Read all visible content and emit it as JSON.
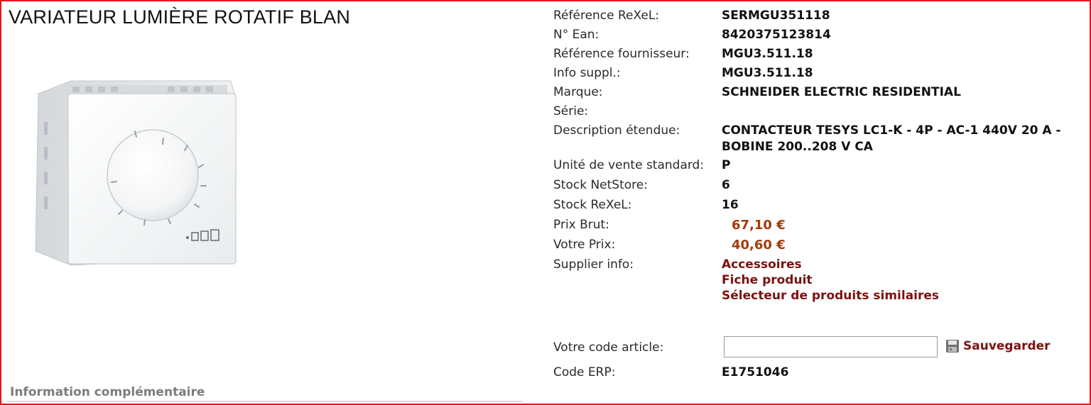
{
  "product": {
    "title": "VARIATEUR LUMIÈRE ROTATIF BLAN",
    "image_icon": "dimmer-switch-product-photo",
    "info_heading": "Information complémentaire"
  },
  "details": {
    "ref_rexel_label": "Référence ReXeL:",
    "ref_rexel_value": "SERMGU351118",
    "ean_label": "N° Ean:",
    "ean_value": "8420375123814",
    "ref_supplier_label": "Référence fournisseur:",
    "ref_supplier_value": "MGU3.511.18",
    "info_suppl_label": "Info suppl.:",
    "info_suppl_value": "MGU3.511.18",
    "brand_label": "Marque:",
    "brand_value": "SCHNEIDER ELECTRIC RESIDENTIAL",
    "series_label": "Série:",
    "series_value": "",
    "description_label": "Description étendue:",
    "description_line1": "CONTACTEUR TESYS LC1-K - 4P - AC-1 440V 20 A -",
    "description_line2": "BOBINE 200..208 V CA",
    "unit_label": "Unité de vente standard:",
    "unit_value": "P",
    "stock_netstore_label": "Stock NetStore:",
    "stock_netstore_value": "6",
    "stock_rexel_label": "Stock ReXeL:",
    "stock_rexel_value": "16",
    "price_gross_label": "Prix Brut:",
    "price_gross_value": "67,10 €",
    "price_yours_label": "Votre Prix:",
    "price_yours_value": "40,60 €",
    "supplier_info_label": "Supplier info:",
    "links": [
      "Accessoires",
      "Fiche produit",
      "Sélecteur de produits similaires"
    ],
    "article_code_label": "Votre code article:",
    "article_code_value": "",
    "save_label": "Sauvegarder",
    "save_icon": "floppy-disk-icon",
    "erp_label": "Code ERP:",
    "erp_value": "E1751046"
  },
  "colors": {
    "frame_border": "#e8141b",
    "price": "#a33a0b",
    "link": "#7d1010",
    "heading_gray": "#7c7c7c"
  }
}
